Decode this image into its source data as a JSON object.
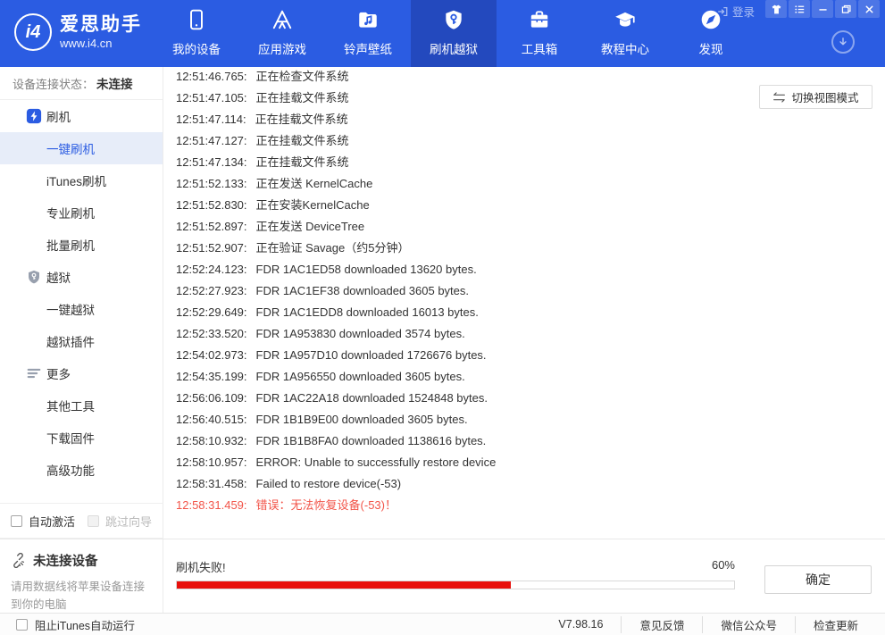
{
  "colors": {
    "nav_bg": "#2B5CE2",
    "nav_active_bg": "#2349BE",
    "sidebar_active_bg": "#E7EDF9",
    "accent_blue": "#2B5CE2",
    "error_text": "#F25449",
    "progress_red": "#E8100C"
  },
  "nav": {
    "logo_title": "爱思助手",
    "logo_site": "www.i4.cn",
    "logo_badge": "i4",
    "login_label": "登录",
    "tabs": [
      {
        "label": "我的设备",
        "icon": "phone-icon"
      },
      {
        "label": "应用游戏",
        "icon": "appstore-icon"
      },
      {
        "label": "铃声壁纸",
        "icon": "ringtone-folder-icon"
      },
      {
        "label": "刷机越狱",
        "icon": "shield-key-icon",
        "active": true
      },
      {
        "label": "工具箱",
        "icon": "toolbox-icon"
      },
      {
        "label": "教程中心",
        "icon": "graduation-cap-icon"
      },
      {
        "label": "发现",
        "icon": "compass-icon"
      }
    ],
    "titlebar_icons": [
      "login-icon",
      "theme-icon",
      "list-icon",
      "minimize-icon",
      "maximize-icon",
      "close-icon",
      "download-circle-icon"
    ]
  },
  "sidebar": {
    "status_label": "设备连接状态：",
    "status_value": "未连接",
    "items": [
      {
        "label": "刷机",
        "icon": "flash-device-icon"
      },
      {
        "label": "一键刷机",
        "active": true
      },
      {
        "label": "iTunes刷机"
      },
      {
        "label": "专业刷机"
      },
      {
        "label": "批量刷机"
      },
      {
        "label": "越狱",
        "icon": "shield-key-gray-icon"
      },
      {
        "label": "一键越狱"
      },
      {
        "label": "越狱插件"
      },
      {
        "label": "更多",
        "icon": "more-lines-icon"
      },
      {
        "label": "其他工具"
      },
      {
        "label": "下载固件"
      },
      {
        "label": "高级功能"
      }
    ],
    "auto_activate_label": "自动激活",
    "skip_wizard_label": "跳过向导",
    "device_panel": {
      "title": "未连接设备",
      "title_icon": "broken-link-icon",
      "desc": "请用数据线将苹果设备连接到你的电脑"
    }
  },
  "main": {
    "viewmode_button": "切换视图模式",
    "viewmode_icon": "swap-arrows-icon"
  },
  "log": {
    "lines": [
      {
        "time": "12:51:46.765:",
        "text": "正在检查文件系统"
      },
      {
        "time": "12:51:47.105:",
        "text": "正在挂载文件系统"
      },
      {
        "time": "12:51:47.114:",
        "text": "正在挂载文件系统"
      },
      {
        "time": "12:51:47.127:",
        "text": "正在挂载文件系统"
      },
      {
        "time": "12:51:47.134:",
        "text": "正在挂载文件系统"
      },
      {
        "time": "12:51:52.133:",
        "text": "正在发送 KernelCache"
      },
      {
        "time": "12:51:52.830:",
        "text": "正在安装KernelCache"
      },
      {
        "time": "12:51:52.897:",
        "text": "正在发送 DeviceTree"
      },
      {
        "time": "12:51:52.907:",
        "text": "正在验证 Savage（约5分钟）"
      },
      {
        "time": "12:52:24.123:",
        "text": "FDR 1AC1ED58 downloaded 13620 bytes."
      },
      {
        "time": "12:52:27.923:",
        "text": "FDR 1AC1EF38 downloaded 3605 bytes."
      },
      {
        "time": "12:52:29.649:",
        "text": "FDR 1AC1EDD8 downloaded 16013 bytes."
      },
      {
        "time": "12:52:33.520:",
        "text": "FDR 1A953830 downloaded 3574 bytes."
      },
      {
        "time": "12:54:02.973:",
        "text": "FDR 1A957D10 downloaded 1726676 bytes."
      },
      {
        "time": "12:54:35.199:",
        "text": "FDR 1A956550 downloaded 3605 bytes."
      },
      {
        "time": "12:56:06.109:",
        "text": "FDR 1AC22A18 downloaded 1524848 bytes."
      },
      {
        "time": "12:56:40.515:",
        "text": "FDR 1B1B9E00 downloaded 3605 bytes."
      },
      {
        "time": "12:58:10.932:",
        "text": "FDR 1B1B8FA0 downloaded 1138616 bytes."
      },
      {
        "time": "12:58:10.957:",
        "text": "ERROR: Unable to successfully restore device"
      },
      {
        "time": "12:58:31.458:",
        "text": "Failed to restore device(-53)"
      },
      {
        "time": "12:58:31.459:",
        "text": "错误：无法恢复设备(-53)！",
        "error": true
      }
    ]
  },
  "progress": {
    "status": "刷机失败!",
    "percent_label": "60%",
    "value": 60,
    "ok_button": "确定"
  },
  "footer": {
    "block_itunes_label": "阻止iTunes自动运行",
    "version": "V7.98.16",
    "links": [
      "意见反馈",
      "微信公众号",
      "检查更新"
    ]
  }
}
